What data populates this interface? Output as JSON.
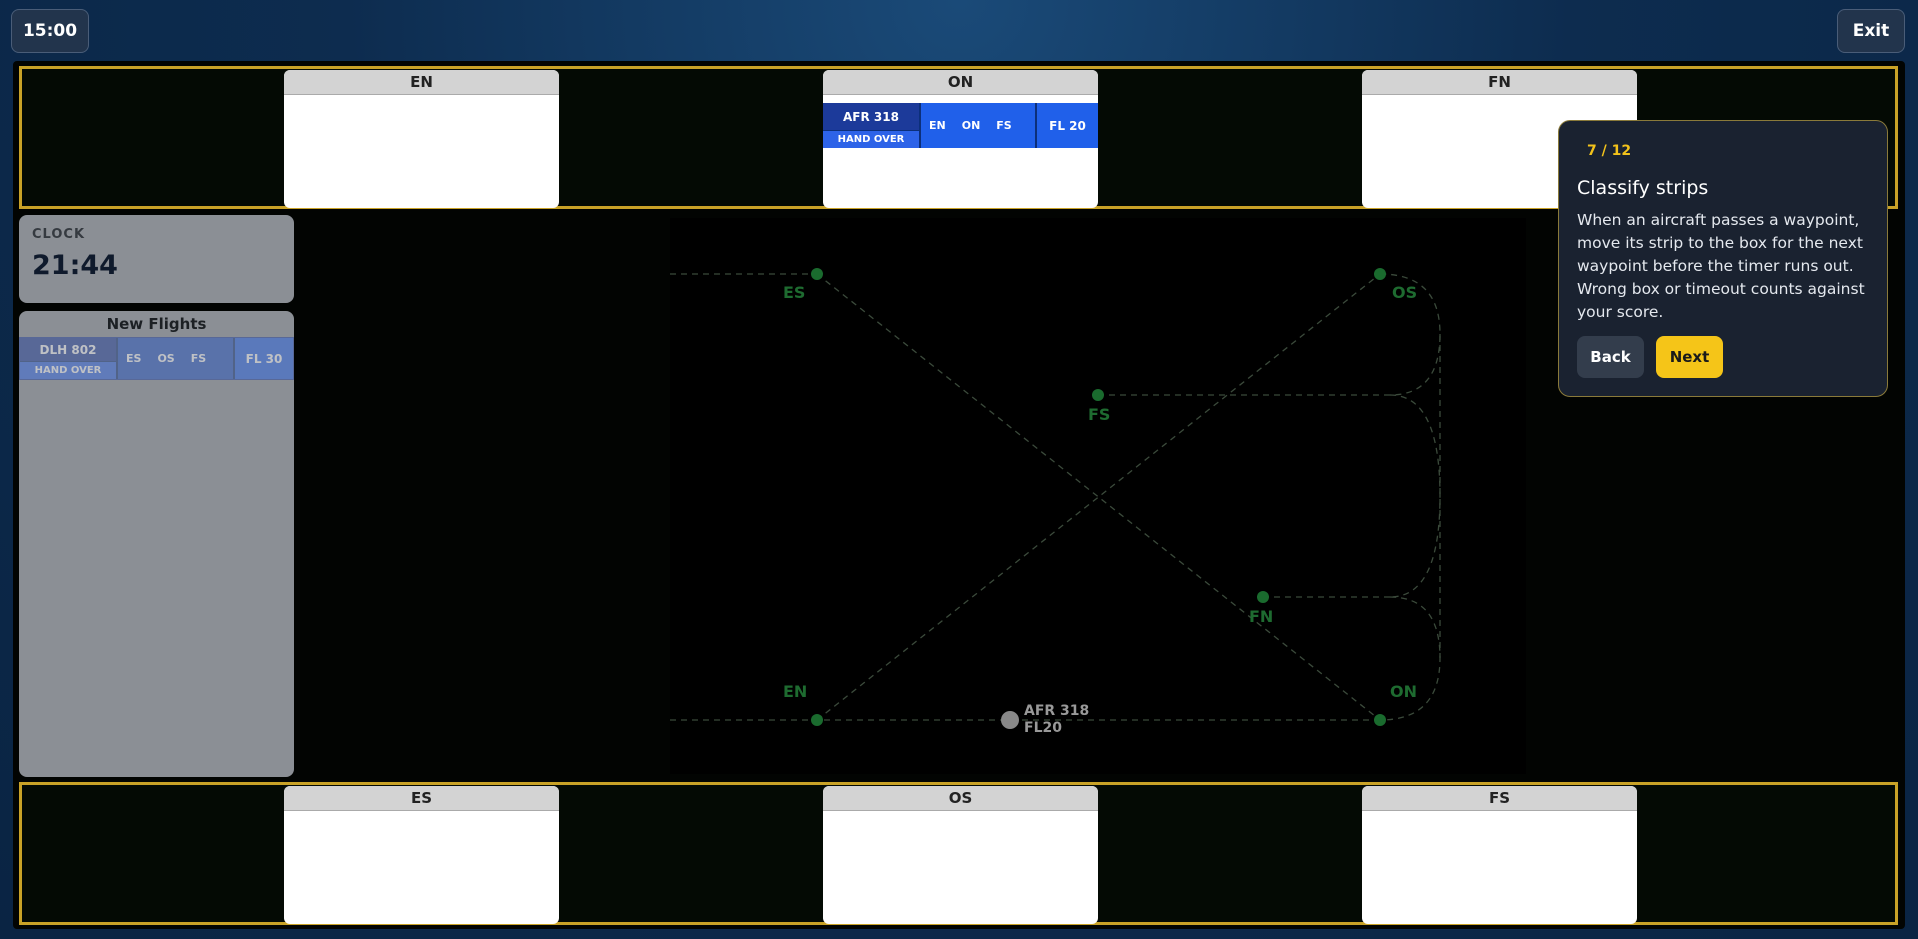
{
  "header": {
    "timer": "15:00",
    "exit_label": "Exit"
  },
  "top_boxes": [
    {
      "label": "EN"
    },
    {
      "label": "ON"
    },
    {
      "label": "FN"
    }
  ],
  "bottom_boxes": [
    {
      "label": "ES"
    },
    {
      "label": "OS"
    },
    {
      "label": "FS"
    }
  ],
  "strips": {
    "afr318": {
      "callsign": "AFR 318",
      "status": "HAND OVER",
      "route": [
        "EN",
        "ON",
        "FS"
      ],
      "level": "FL 20"
    },
    "dlh802": {
      "callsign": "DLH 802",
      "status": "HAND OVER",
      "route": [
        "ES",
        "OS",
        "FS"
      ],
      "level": "FL 30"
    }
  },
  "clock": {
    "label": "CLOCK",
    "value": "21:44"
  },
  "new_flights": {
    "title": "New Flights"
  },
  "radar": {
    "waypoints": [
      "ES",
      "OS",
      "FS",
      "FN",
      "EN",
      "ON"
    ],
    "aircraft": {
      "callsign": "AFR 318",
      "level": "FL20"
    },
    "colors": {
      "waypoint": "#1a6b2e",
      "route_line": "#2a3a2a",
      "aircraft": "#888888"
    }
  },
  "tutorial": {
    "step": "7 / 12",
    "title": "Classify strips",
    "body": "When an aircraft passes a waypoint, move its strip to the box for the next waypoint before the timer runs out. Wrong box or timeout counts against your score.",
    "back_label": "Back",
    "next_label": "Next"
  },
  "colors": {
    "accent": "#c9a227",
    "next_button": "#f5c518",
    "strip_blue": "#2060ea"
  }
}
